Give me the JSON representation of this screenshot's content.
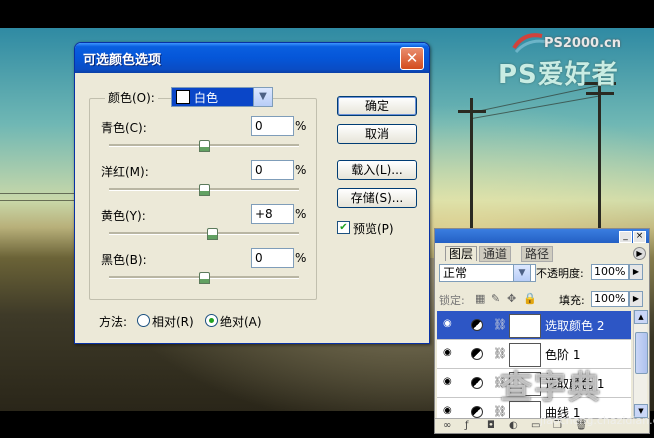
{
  "watermark": {
    "top": "PS2000.cn",
    "bottom": "PS爱好者",
    "bottom2": "查字典",
    "bottom3": "jiaocheng.chazidian.com"
  },
  "dialog": {
    "title": "可选颜色选项",
    "colors_label": "颜色(O):",
    "color_value": "白色",
    "rows": [
      {
        "label": "青色(C):",
        "value": "0",
        "unit": "%",
        "slider_pos": 0.5
      },
      {
        "label": "洋红(M):",
        "value": "0",
        "unit": "%",
        "slider_pos": 0.5
      },
      {
        "label": "黄色(Y):",
        "value": "+8",
        "unit": "%",
        "slider_pos": 0.54
      },
      {
        "label": "黑色(B):",
        "value": "0",
        "unit": "%",
        "slider_pos": 0.5
      }
    ],
    "buttons": {
      "ok": "确定",
      "cancel": "取消",
      "load": "载入(L)...",
      "save": "存储(S)..."
    },
    "preview": {
      "label": "预览(P)",
      "checked": true
    },
    "method": {
      "label": "方法:",
      "relative": "相对(R)",
      "absolute": "绝对(A)",
      "selected": "absolute"
    }
  },
  "layers_panel": {
    "tabs": [
      "图层",
      "通道",
      "路径"
    ],
    "blend_mode": "正常",
    "opacity_label": "不透明度:",
    "opacity": "100%",
    "lock_label": "锁定:",
    "fill_label": "填充:",
    "fill": "100%",
    "layers": [
      {
        "name": "选取颜色 2",
        "selected": true
      },
      {
        "name": "色阶 1",
        "selected": false
      },
      {
        "name": "选取颜色 1",
        "selected": false
      },
      {
        "name": "曲线 1",
        "selected": false
      }
    ]
  }
}
